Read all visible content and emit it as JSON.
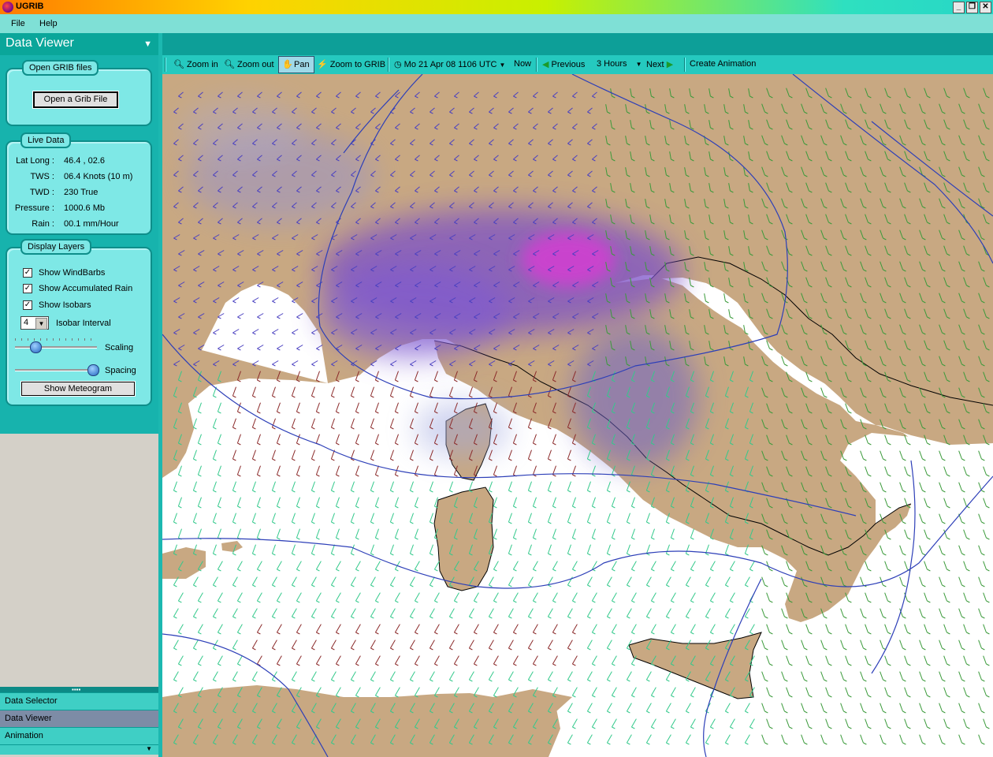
{
  "window": {
    "title": "UGRIB"
  },
  "menu": {
    "file": "File",
    "help": "Help"
  },
  "left_panel": {
    "header": "Data Viewer",
    "open_grib": {
      "title": "Open GRIB files",
      "button": "Open a Grib File"
    },
    "live_data": {
      "title": "Live Data",
      "latlong_label": "Lat Long :",
      "latlong_value": "46.4 ,  02.6",
      "tws_label": "TWS :",
      "tws_value": "06.4 Knots (10 m)",
      "twd_label": "TWD :",
      "twd_value": "230 True",
      "pressure_label": "Pressure :",
      "pressure_value": "1000.6 Mb",
      "rain_label": "Rain :",
      "rain_value": "00.1 mm/Hour"
    },
    "display_layers": {
      "title": "Display Layers",
      "show_windbarbs": "Show WindBarbs",
      "show_rain": "Show Accumulated Rain",
      "show_isobars": "Show Isobars",
      "isobar_interval_value": "4",
      "isobar_interval_label": "Isobar Interval",
      "scaling_label": "Scaling",
      "scaling_level": 0.25,
      "spacing_label": "Spacing",
      "spacing_level": 0.95,
      "meteogram_button": "Show Meteogram"
    },
    "nav": [
      "Data Selector",
      "Data Viewer",
      "Animation"
    ]
  },
  "toolbar": {
    "zoom_in": "Zoom in",
    "zoom_out": "Zoom out",
    "pan": "Pan",
    "zoom_to_grib": "Zoom to GRIB",
    "datetime": "Mo 21 Apr 08 1106 UTC",
    "now": "Now",
    "previous": "Previous",
    "step": "3 Hours",
    "next": "Next",
    "create_animation": "Create Animation"
  },
  "colors": {
    "land": "#c8a882",
    "sea_rain": "#7f55c8",
    "sea_clear": "#ffffff",
    "isobar": "#2d3fb8",
    "barb_light": "#33c98b",
    "barb_med": "#3a9a3a",
    "barb_strong": "#8b2a2a",
    "barb_calm": "#4a40c0",
    "panel_accent": "#0aa69a"
  }
}
